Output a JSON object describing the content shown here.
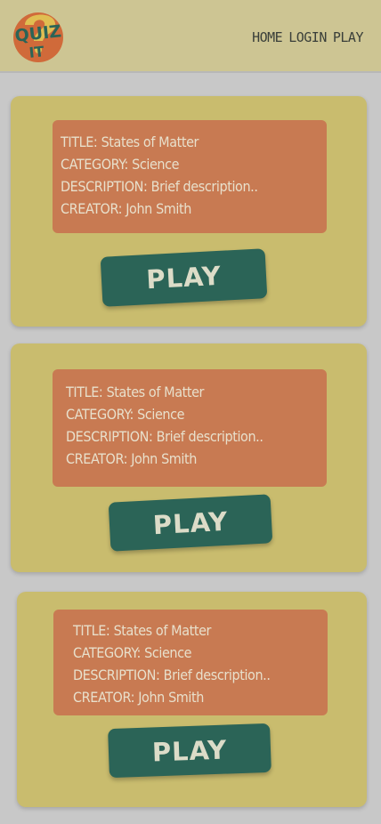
{
  "header": {
    "logo_text_top": "QUIZ",
    "logo_text_bottom": "IT",
    "nav": [
      {
        "label": "HOME"
      },
      {
        "label": "LOGIN"
      },
      {
        "label": "PLAY"
      }
    ]
  },
  "colors": {
    "background": "#c8c8c8",
    "header": "#cdc593",
    "card": "#c9bc6e",
    "info_box": "#c87a52",
    "play_button": "#2b6457",
    "logo_yellow": "#e0be52",
    "logo_orange": "#d06a3a",
    "logo_teal": "#2b6457"
  },
  "quizzes": [
    {
      "title_label": "TITLE:",
      "title": "States of Matter",
      "category_label": "CATEGORY:",
      "category": "Science",
      "description_label": "DESCRIPTION:",
      "description": "Brief description..",
      "creator_label": "CREATOR:",
      "creator": "John Smith",
      "play_label": "PLAY"
    },
    {
      "title_label": "TITLE:",
      "title": "States of Matter",
      "category_label": "CATEGORY:",
      "category": "Science",
      "description_label": "DESCRIPTION:",
      "description": "Brief description..",
      "creator_label": "CREATOR:",
      "creator": "John Smith",
      "play_label": "PLAY"
    },
    {
      "title_label": "TITLE:",
      "title": "States of Matter",
      "category_label": "CATEGORY:",
      "category": "Science",
      "description_label": "DESCRIPTION:",
      "description": "Brief description..",
      "creator_label": "CREATOR:",
      "creator": "John Smith",
      "play_label": "PLAY"
    }
  ]
}
